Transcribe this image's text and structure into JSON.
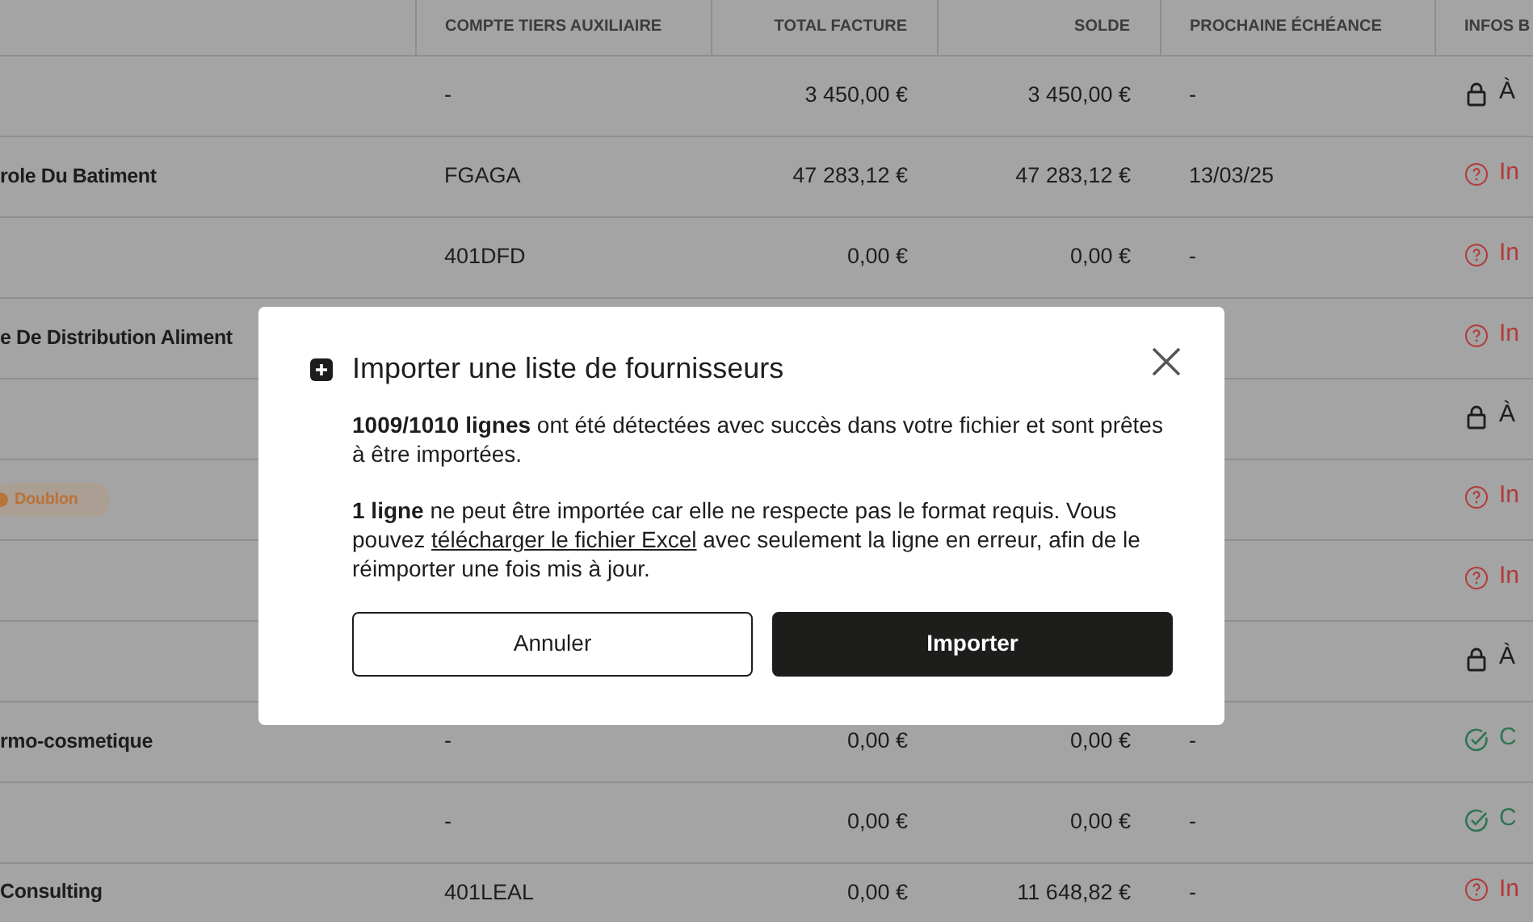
{
  "table": {
    "columns": [
      "",
      "COMPTE TIERS AUXILIAIRE",
      "TOTAL FACTURE",
      "SOLDE",
      "PROCHAINE ÉCHÉANCE",
      "INFOS B"
    ],
    "rows": [
      {
        "compte": "-",
        "total": "3 450,00 €",
        "solde": "3 450,00 €",
        "echeance": "-",
        "info": {
          "kind": "lock",
          "text": "À"
        }
      },
      {
        "name": "role Du Batiment",
        "compte": "FGAGA",
        "total": "47 283,12 €",
        "solde": "47 283,12 €",
        "echeance": "13/03/25",
        "info": {
          "kind": "help",
          "text": "In"
        }
      },
      {
        "compte": "401DFD",
        "total": "0,00 €",
        "solde": "0,00 €",
        "echeance": "-",
        "info": {
          "kind": "help",
          "text": "In"
        }
      },
      {
        "name": "e De Distribution Aliment",
        "info": {
          "kind": "help",
          "text": "In"
        }
      },
      {
        "info": {
          "kind": "lock",
          "text": "À"
        }
      },
      {
        "badge": {
          "text": "Doublon",
          "color": "#b8733a"
        },
        "info": {
          "kind": "help",
          "text": "In"
        }
      },
      {
        "info": {
          "kind": "help",
          "text": "In"
        }
      },
      {
        "info": {
          "kind": "lock",
          "text": "À"
        }
      },
      {
        "name": "rmo-cosmetique",
        "compte": "-",
        "total": "0,00 €",
        "solde": "0,00 €",
        "echeance": "-",
        "info": {
          "kind": "check",
          "text": "C"
        }
      },
      {
        "compte": "-",
        "total": "0,00 €",
        "solde": "0,00 €",
        "echeance": "-",
        "info": {
          "kind": "check",
          "text": "C"
        }
      },
      {
        "name": "Consulting",
        "compte": "401LEAL",
        "total": "0,00 €",
        "solde": "11 648,82 €",
        "echeance": "-",
        "info": {
          "kind": "help",
          "text": "In"
        }
      }
    ]
  },
  "modal": {
    "title": "Importer une liste de fournisseurs",
    "paragraphs": [
      "**1009/1010 lignes** ont été détectées avec succès dans votre fichier et sont prêtes à être importées."
    ],
    "error": {
      "lead": "**1 ligne** ne peut être importée car elle ne respecte pas le format requis. Vous pouvez ",
      "link": "télécharger le fichier Excel",
      "tail": " avec seulement la ligne en erreur, afin de le réimporter une fois mis à jour."
    },
    "buttons": [
      {
        "label": "Annuler",
        "kind": "secondary"
      },
      {
        "label": "Importer",
        "kind": "primary"
      }
    ]
  }
}
